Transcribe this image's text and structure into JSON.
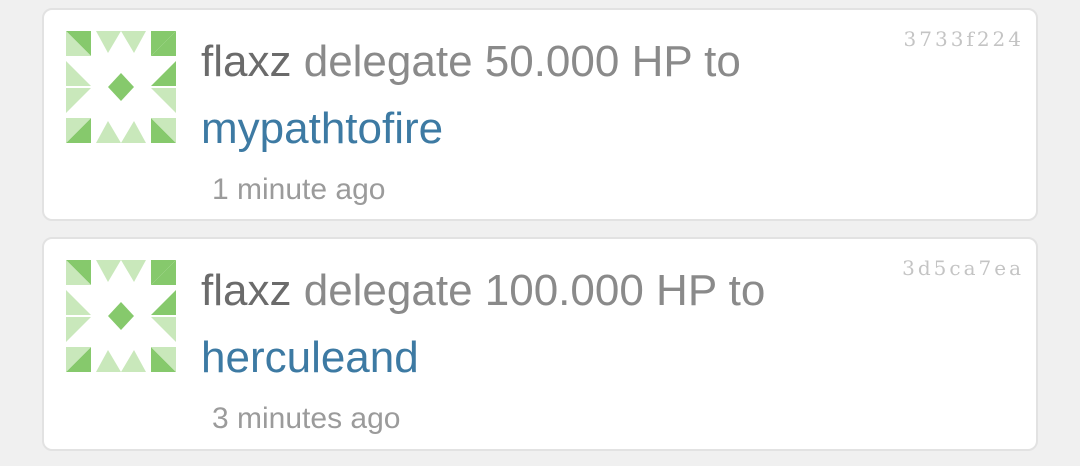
{
  "colors": {
    "card_background": "#ffffff",
    "page_background": "#f0f0f0",
    "user_text": "#6b6b6b",
    "action_text": "#8a8a8a",
    "link_text": "#3d7aa3",
    "timestamp_text": "#9b9b9b",
    "txid_text": "#c4c4c4",
    "identicon_light": "#c9e8bb",
    "identicon_dark": "#86c96c"
  },
  "operations": [
    {
      "avatar_icon": "identicon-icon",
      "user": "flaxz",
      "action": "delegate 50.000 HP to",
      "target": "mypathtofire",
      "time": "1 minute ago",
      "txid": "3733f224"
    },
    {
      "avatar_icon": "identicon-icon",
      "user": "flaxz",
      "action": "delegate 100.000 HP to",
      "target": "herculeand",
      "time": "3 minutes ago",
      "txid": "3d5ca7ea"
    }
  ]
}
